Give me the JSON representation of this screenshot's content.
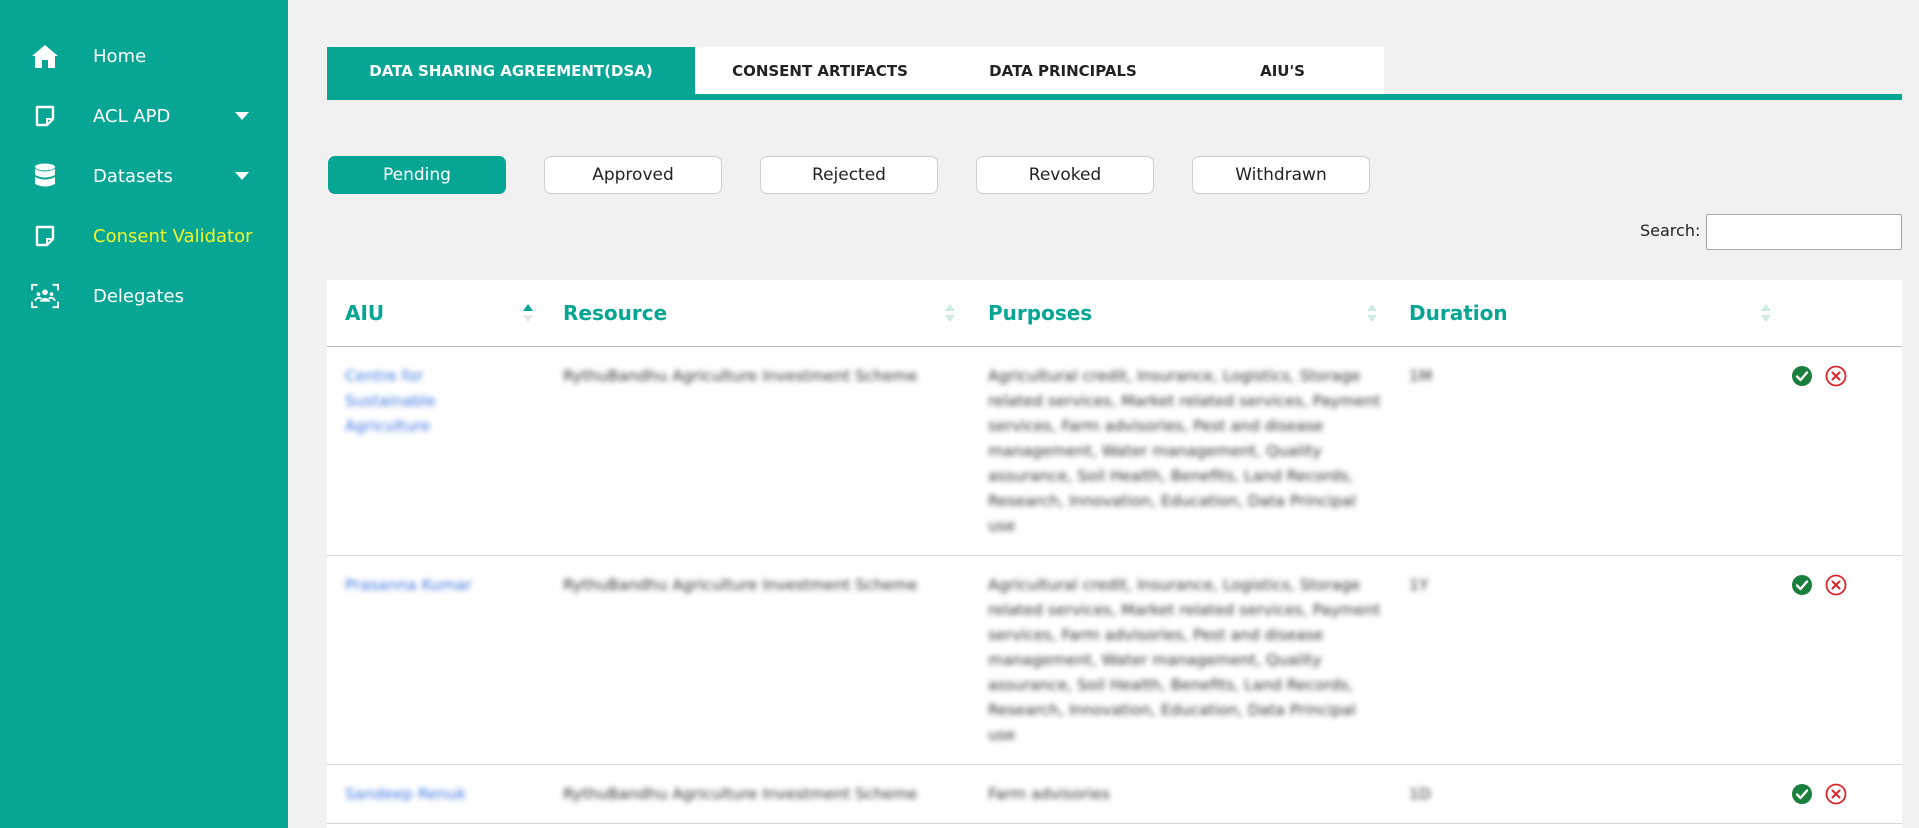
{
  "sidebar": {
    "items": [
      {
        "label": "Home",
        "icon": "home-icon",
        "has_dropdown": false,
        "active": false
      },
      {
        "label": "ACL APD",
        "icon": "note-icon",
        "has_dropdown": true,
        "active": false
      },
      {
        "label": "Datasets",
        "icon": "database-icon",
        "has_dropdown": true,
        "active": false
      },
      {
        "label": "Consent Validator",
        "icon": "note-icon",
        "has_dropdown": false,
        "active": true
      },
      {
        "label": "Delegates",
        "icon": "users-icon",
        "has_dropdown": false,
        "active": false
      }
    ]
  },
  "tabs": [
    {
      "label": "DATA SHARING AGREEMENT(DSA)",
      "active": true
    },
    {
      "label": "CONSENT ARTIFACTS",
      "active": false
    },
    {
      "label": "DATA PRINCIPALS",
      "active": false
    },
    {
      "label": "AIU'S",
      "active": false
    }
  ],
  "status_filters": [
    {
      "label": "Pending",
      "active": true
    },
    {
      "label": "Approved",
      "active": false
    },
    {
      "label": "Rejected",
      "active": false
    },
    {
      "label": "Revoked",
      "active": false
    },
    {
      "label": "Withdrawn",
      "active": false
    }
  ],
  "search": {
    "label": "Search:",
    "value": ""
  },
  "table": {
    "columns": [
      "AIU",
      "Resource",
      "Purposes",
      "Duration"
    ],
    "rows": [
      {
        "aiu": "Centre for Sustainable Agriculture",
        "resource": "RythuBandhu Agriculture Investment Scheme",
        "purposes": "Agricultural credit, Insurance, Logistics, Storage related services, Market related services, Payment services, Farm advisories, Pest and disease management, Water management, Quality assurance, Soil Health, Benefits, Land Records, Research, Innovation, Education, Data Principal use",
        "duration": "1M"
      },
      {
        "aiu": "Prasanna Kumar",
        "resource": "RythuBandhu Agriculture Investment Scheme",
        "purposes": "Agricultural credit, Insurance, Logistics, Storage related services, Market related services, Payment services, Farm advisories, Pest and disease management, Water management, Quality assurance, Soil Health, Benefits, Land Records, Research, Innovation, Education, Data Principal use",
        "duration": "1Y"
      },
      {
        "aiu": "Sandeep Renuk",
        "resource": "RythuBandhu Agriculture Investment Scheme",
        "purposes": "Farm advisories",
        "duration": "1D"
      }
    ]
  },
  "colors": {
    "primary": "#06a594",
    "active_nav": "#f3f72a",
    "approve": "#1a7f3c",
    "reject": "#d9262b",
    "link": "#3b73e0"
  }
}
